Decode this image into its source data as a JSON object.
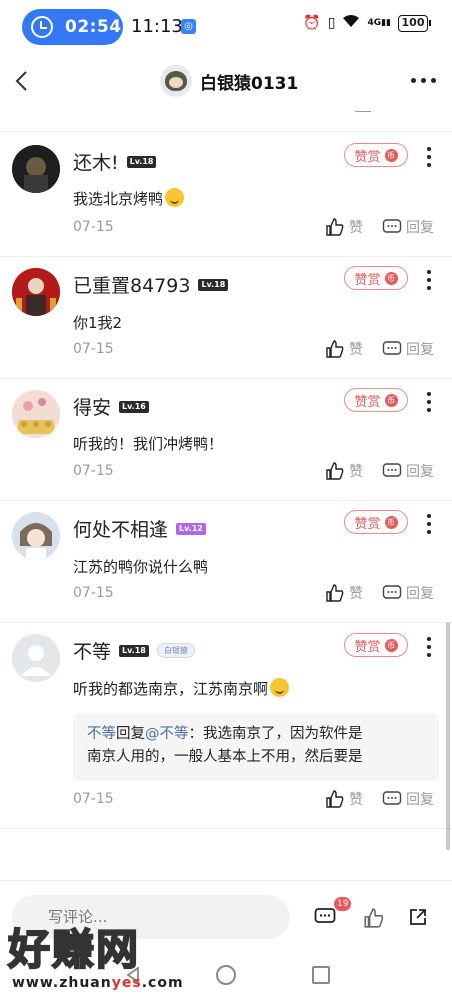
{
  "status_bar": {
    "timer": "02:54",
    "time": "11:13",
    "network": "4G",
    "battery": "100"
  },
  "header": {
    "title": "白银猿0131",
    "dash": "—"
  },
  "comments": [
    {
      "name": "还木!",
      "level": "Lv.18",
      "reward": "赞赏",
      "reward_mark": "币",
      "text": "我选北京烤鸭",
      "date": "07-15",
      "like": "赞",
      "reply": "回复"
    },
    {
      "name": "已重置84793",
      "level": "Lv.18",
      "reward": "赞赏",
      "reward_mark": "币",
      "text": "你1我2",
      "date": "07-15",
      "like": "赞",
      "reply": "回复"
    },
    {
      "name": "得安",
      "level": "Lv.16",
      "reward": "赞赏",
      "reward_mark": "币",
      "text": "听我的！我们冲烤鸭！",
      "date": "07-15",
      "like": "赞",
      "reply": "回复"
    },
    {
      "name": "何处不相逢",
      "level": "Lv.12",
      "reward": "赞赏",
      "reward_mark": "币",
      "text": "江苏的鸭你说什么鸭",
      "date": "07-15",
      "like": "赞",
      "reply": "回复"
    },
    {
      "name": "不等",
      "level": "Lv.18",
      "badge": "白银猿",
      "reward": "赞赏",
      "reward_mark": "币",
      "text": "听我的都选南京，江苏南京啊",
      "quote": {
        "from": "不等",
        "action": "回复",
        "to": "@不等",
        "colon": "：",
        "text_line1": "我选南京了，因为软件是",
        "text_line2": "南京人用的，一般人基本上不用，然后要是"
      },
      "date": "07-15",
      "like": "赞",
      "reply": "回复"
    }
  ],
  "bottom_bar": {
    "input_placeholder": "写评论...",
    "comment_count": "19"
  },
  "watermark": {
    "title": "好赚网",
    "url_prefix": "www.zhuan",
    "url_red": "yes",
    "url_suffix": ".com"
  }
}
